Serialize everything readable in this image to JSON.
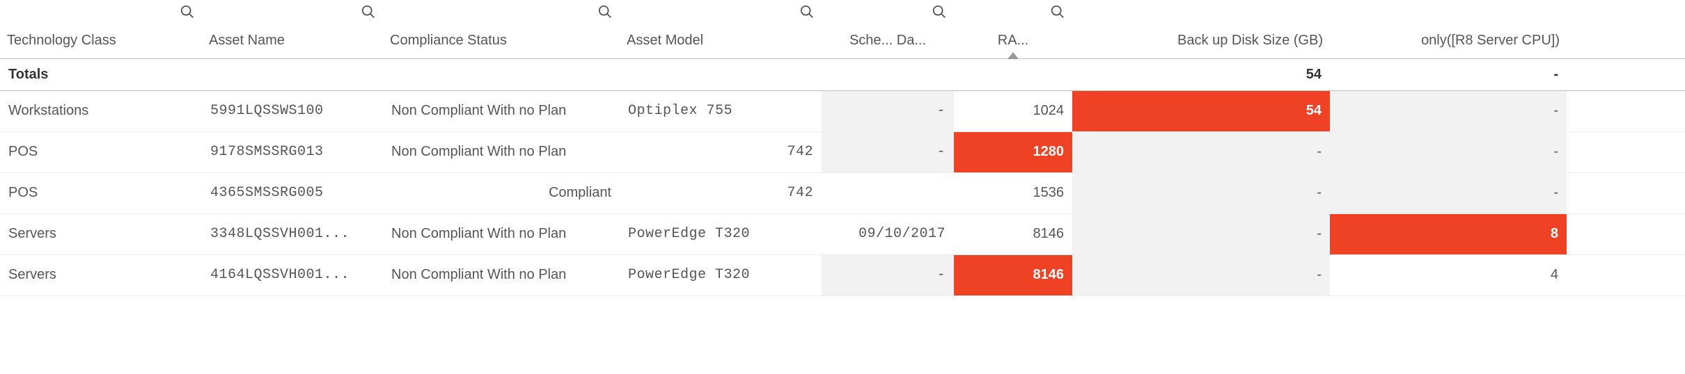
{
  "columns": {
    "tech_class": "Technology Class",
    "asset_name": "Asset Name",
    "compliance": "Compliance Status",
    "asset_model": "Asset Model",
    "sched_date": "Sche... Da...",
    "ram": "RA...",
    "backup": "Back up Disk Size (GB)",
    "r8": "only([R8 Server CPU])"
  },
  "totals": {
    "label": "Totals",
    "backup": "54",
    "r8": "-"
  },
  "rows": [
    {
      "tech_class": "Workstations",
      "asset_name": "5991LQSSWS100",
      "compliance": "Non Compliant With no Plan",
      "asset_model": "Optiplex 755",
      "sched_date": "-",
      "ram": "1024",
      "backup": "54",
      "r8": "-",
      "hl": {
        "backup": true
      },
      "grey": {
        "sched_date": true,
        "r8": true
      }
    },
    {
      "tech_class": "POS",
      "asset_name": "9178SMSSRG013",
      "compliance": "Non Compliant With no Plan",
      "asset_model": "742",
      "sched_date": "-",
      "ram": "1280",
      "backup": "-",
      "r8": "-",
      "hl": {
        "ram": true
      },
      "grey": {
        "sched_date": true,
        "backup": true,
        "r8": true
      },
      "model_right": true
    },
    {
      "tech_class": "POS",
      "asset_name": "4365SMSSRG005",
      "compliance": "Compliant",
      "asset_model": "742",
      "sched_date": "",
      "ram": "1536",
      "backup": "-",
      "r8": "-",
      "hl": {},
      "grey": {
        "backup": true,
        "r8": true
      },
      "model_right": true,
      "compliance_right": true
    },
    {
      "tech_class": "Servers",
      "asset_name": "3348LQSSVH001...",
      "compliance": "Non Compliant With no Plan",
      "asset_model": "PowerEdge T320",
      "sched_date": "09/10/2017",
      "ram": "8146",
      "backup": "-",
      "r8": "8",
      "hl": {
        "r8": true
      },
      "grey": {
        "backup": true
      }
    },
    {
      "tech_class": "Servers",
      "asset_name": "4164LQSSVH001...",
      "compliance": "Non Compliant With no Plan",
      "asset_model": "PowerEdge T320",
      "sched_date": "-",
      "ram": "8146",
      "backup": "-",
      "r8": "4",
      "hl": {
        "ram": true
      },
      "grey": {
        "sched_date": true,
        "backup": true
      }
    }
  ],
  "chart_data": {
    "type": "table",
    "columns": [
      "Technology Class",
      "Asset Name",
      "Compliance Status",
      "Asset Model",
      "Scheduled Date",
      "RAM",
      "Back up Disk Size (GB)",
      "only([R8 Server CPU])"
    ],
    "totals": {
      "Back up Disk Size (GB)": 54,
      "only([R8 Server CPU])": null
    },
    "rows": [
      [
        "Workstations",
        "5991LQSSWS100",
        "Non Compliant With no Plan",
        "Optiplex 755",
        null,
        1024,
        54,
        null
      ],
      [
        "POS",
        "9178SMSSRG013",
        "Non Compliant With no Plan",
        "742",
        null,
        1280,
        null,
        null
      ],
      [
        "POS",
        "4365SMSSRG005",
        "Compliant",
        "742",
        null,
        1536,
        null,
        null
      ],
      [
        "Servers",
        "3348LQSSVH001...",
        "Non Compliant With no Plan",
        "PowerEdge T320",
        "09/10/2017",
        8146,
        null,
        8
      ],
      [
        "Servers",
        "4164LQSSVH001...",
        "Non Compliant With no Plan",
        "PowerEdge T320",
        null,
        8146,
        null,
        4
      ]
    ],
    "highlight_color": "#ef4123"
  }
}
